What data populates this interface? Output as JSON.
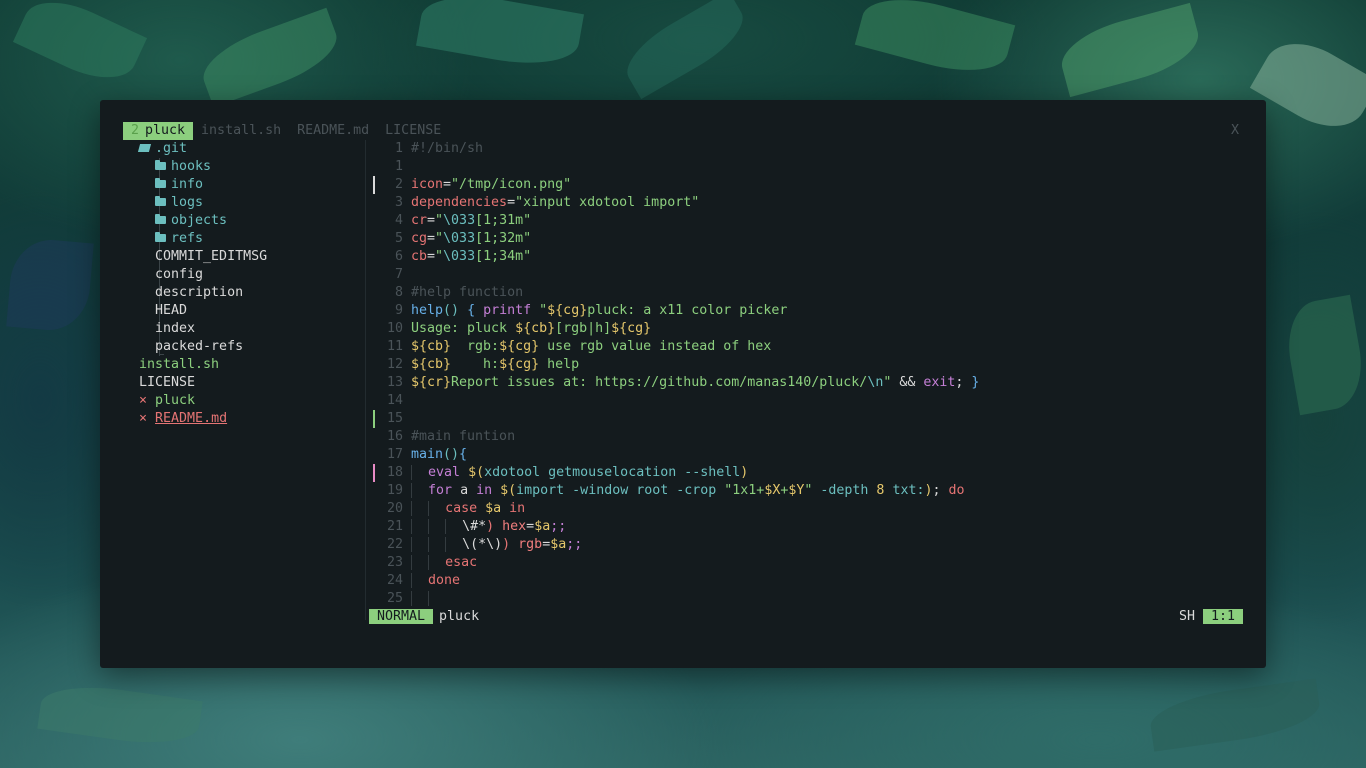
{
  "tabs": [
    {
      "num": "2",
      "label": "pluck",
      "active": true
    },
    {
      "num": "",
      "label": "install.sh",
      "active": false
    },
    {
      "num": "",
      "label": "README.md",
      "active": false
    },
    {
      "num": "",
      "label": "LICENSE",
      "active": false
    }
  ],
  "close_label": "X",
  "tree": {
    "root_dir": ".git",
    "subdirs": [
      "hooks",
      "info",
      "logs",
      "objects",
      "refs"
    ],
    "git_files": [
      "COMMIT_EDITMSG",
      "config",
      "description",
      "HEAD",
      "index",
      "packed-refs"
    ],
    "files": [
      {
        "name": "install.sh",
        "marker": "",
        "style": "green"
      },
      {
        "name": "LICENSE",
        "marker": "",
        "style": "file"
      },
      {
        "name": "pluck",
        "marker": "×",
        "style": "green"
      },
      {
        "name": "README.md",
        "marker": "×",
        "style": "red"
      }
    ]
  },
  "editor": {
    "line_numbers": [
      "1",
      "1",
      "2",
      "3",
      "4",
      "5",
      "6",
      "7",
      "8",
      "9",
      "10",
      "11",
      "12",
      "13",
      "14",
      "15",
      "16",
      "17",
      "18",
      "19",
      "20",
      "21",
      "22",
      "23",
      "24",
      "25"
    ]
  },
  "statusline": {
    "mode": "NORMAL",
    "filename": "pluck",
    "filetype": "SH",
    "position": "1:1"
  },
  "colors": {
    "accent_green": "#8ccf7e",
    "red": "#e57474",
    "background": "#141b1e"
  }
}
